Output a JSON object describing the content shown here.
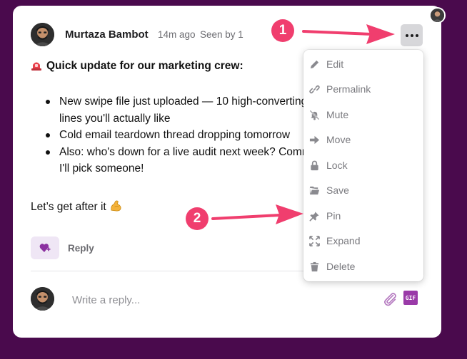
{
  "post": {
    "author": "Murtaza Bambot",
    "time": "14m ago",
    "seen": "Seen by 1",
    "title": "Quick update for our marketing crew:",
    "bullets": [
      "New swipe file just uploaded — 10 high-converting subject lines you'll actually like",
      "Cold email teardown thread dropping tomorrow",
      "Also: who's down for a live audit next week? Comment and I'll pick someone!"
    ],
    "signoff": "Let’s get after it"
  },
  "actions": {
    "reply_label": "Reply",
    "reply_placeholder": "Write a reply...",
    "gif_label": "GIF"
  },
  "menu": {
    "items": [
      {
        "label": "Edit",
        "icon": "pencil-icon"
      },
      {
        "label": "Permalink",
        "icon": "link-icon"
      },
      {
        "label": "Mute",
        "icon": "bell-slash-icon"
      },
      {
        "label": "Move",
        "icon": "arrow-right-icon"
      },
      {
        "label": "Lock",
        "icon": "lock-icon"
      },
      {
        "label": "Save",
        "icon": "folder-icon"
      },
      {
        "label": "Pin",
        "icon": "pin-icon"
      },
      {
        "label": "Expand",
        "icon": "expand-icon"
      },
      {
        "label": "Delete",
        "icon": "trash-icon"
      }
    ]
  },
  "annotations": {
    "badge_1": "1",
    "badge_2": "2"
  },
  "colors": {
    "background": "#4a0a4d",
    "accent": "#f03e6e",
    "gif": "#9a3aa8",
    "react_bg": "#efe6f5"
  }
}
